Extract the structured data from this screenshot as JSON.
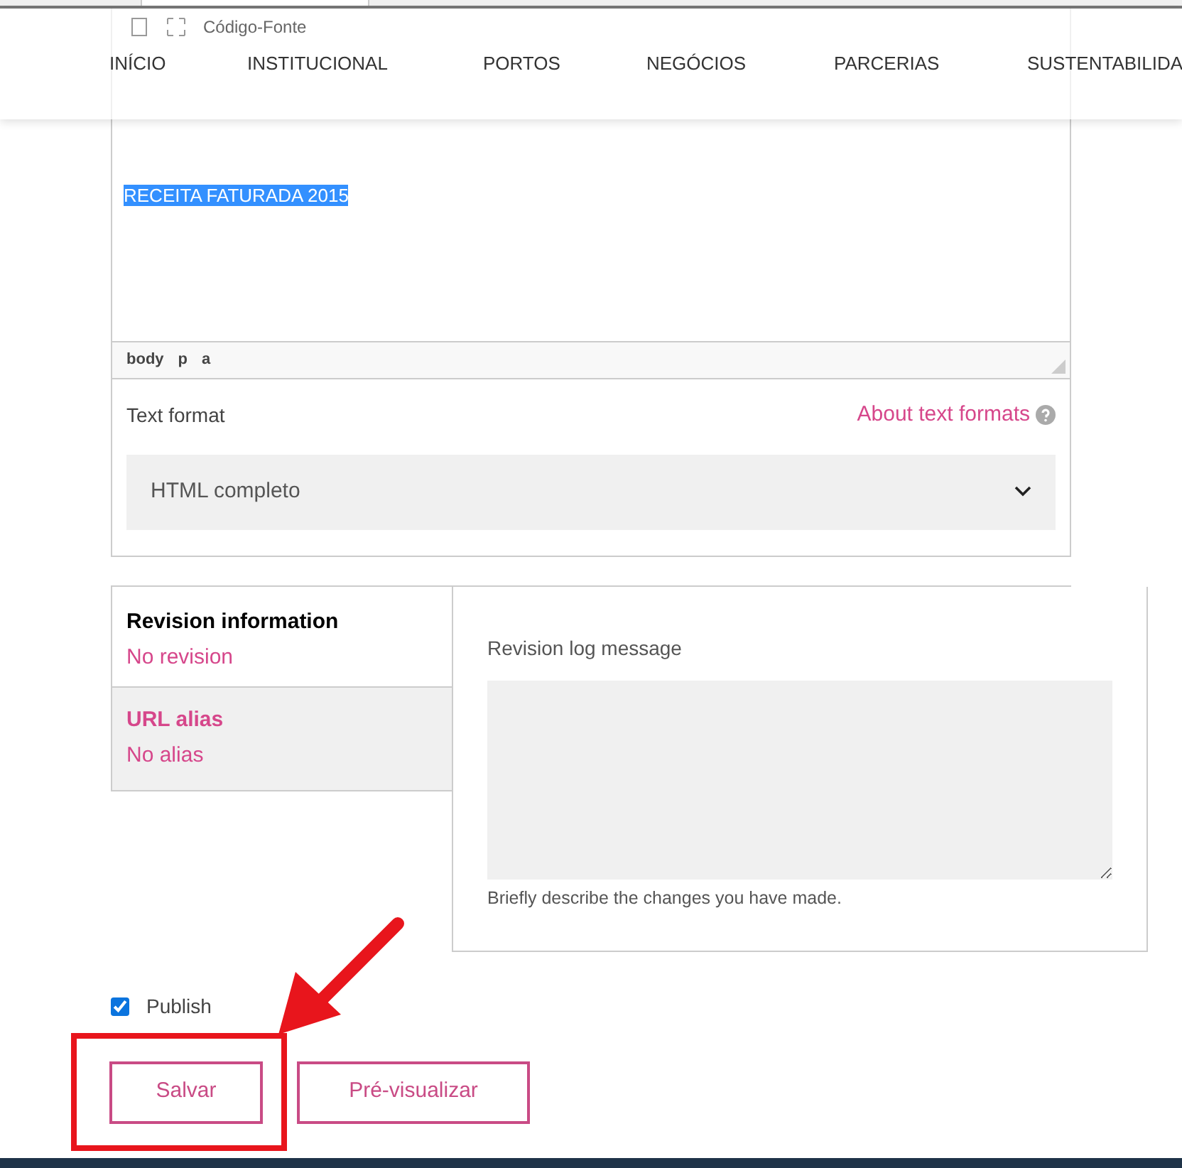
{
  "toolbar": {
    "source_button": "Código-Fonte"
  },
  "nav": [
    "INÍCIO",
    "INSTITUCIONAL",
    "PORTOS",
    "NEGÓCIOS",
    "PARCERIAS",
    "SUSTENTABILIDA"
  ],
  "editor": {
    "text": "RECEITA FATURADA 2015",
    "text_selected": true,
    "path": [
      "body",
      "p",
      "a"
    ]
  },
  "text_format": {
    "label": "Text format",
    "help_link": "About text formats",
    "value": "HTML completo"
  },
  "vertical_tabs": [
    {
      "title": "Revision information",
      "summary": "No revision",
      "selected": true
    },
    {
      "title": "URL alias",
      "summary": "No alias",
      "selected": false
    }
  ],
  "revision": {
    "label": "Revision log message",
    "description": "Briefly describe the changes you have made."
  },
  "publish": {
    "label": "Publish",
    "checked": true
  },
  "buttons": [
    "Salvar",
    "Pré-visualizar"
  ]
}
